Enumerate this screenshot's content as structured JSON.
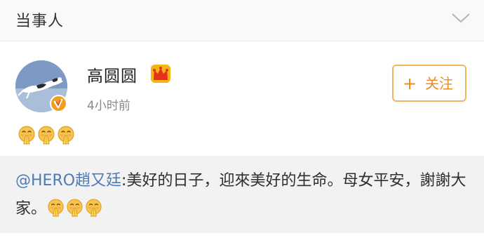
{
  "header": {
    "title": "当事人",
    "collapse_icon": "chevron-down-icon"
  },
  "post": {
    "user": {
      "name": "高圆圆",
      "badge_icon": "crown-icon",
      "verified_icon": "verified-badge-icon",
      "avatar": "avatar-cat-leaping"
    },
    "time": "4小时前",
    "follow_button": {
      "plus": "+",
      "label": "关注"
    },
    "emojis": [
      "pray-emoji",
      "pray-emoji",
      "pray-emoji"
    ]
  },
  "repost": {
    "mention": "@HERO趙又廷",
    "text": ":美好的日子，迎來美好的生命。母女平安，謝謝大家。",
    "emojis": [
      "pray-emoji",
      "pray-emoji",
      "pray-emoji"
    ]
  },
  "colors": {
    "mention": "#4d7bb5",
    "follow_accent": "#ee8a1e",
    "follow_border": "#f3b55e",
    "verified": "#f0a020",
    "crown": "#f4b414"
  }
}
